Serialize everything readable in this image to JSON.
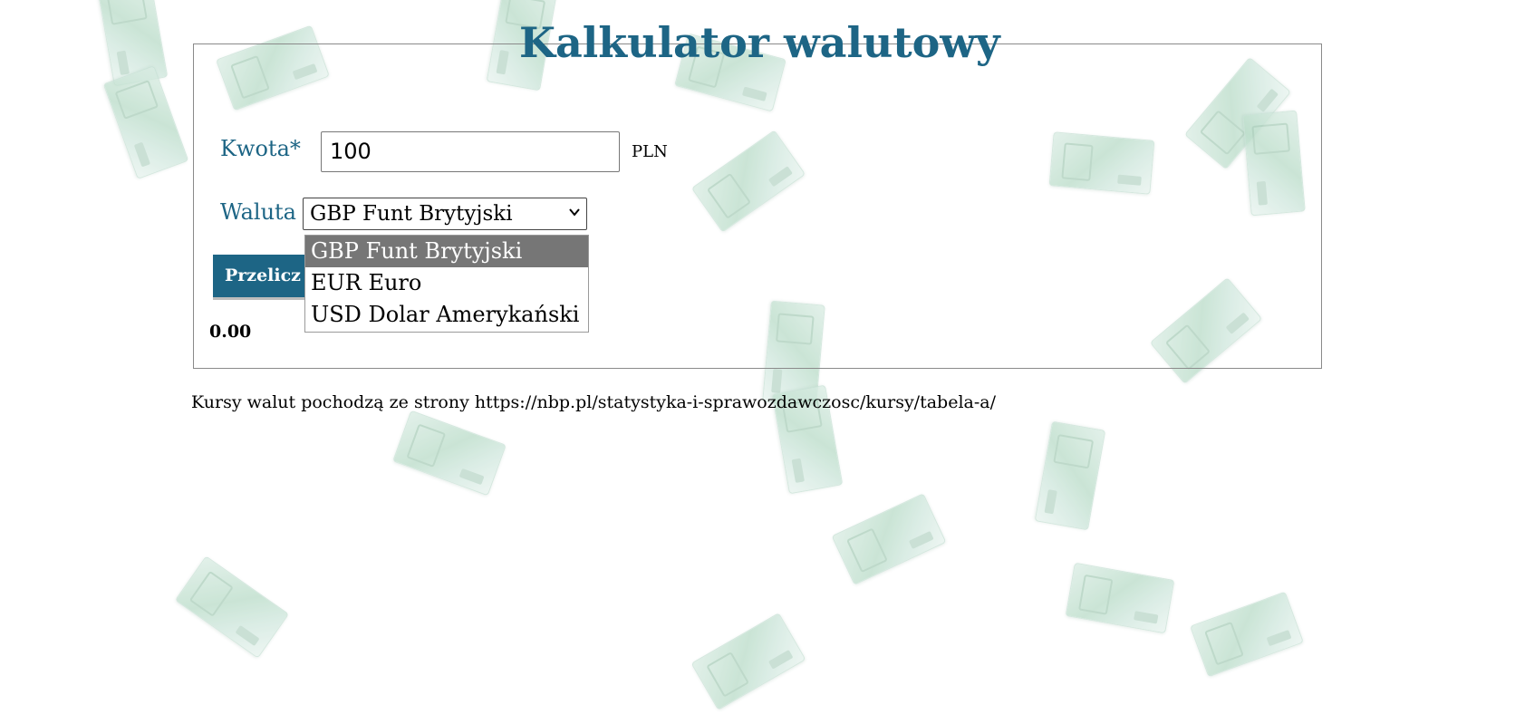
{
  "page": {
    "title": "Kalkulator walutowy"
  },
  "form": {
    "amount_label": "Kwota*",
    "amount_value": "100",
    "amount_unit": "PLN",
    "currency_label": "Waluta",
    "currency_selected": "GBP Funt Brytyjski",
    "currency_options": [
      "GBP Funt Brytyjski",
      "EUR Euro",
      "USD Dolar Amerykański"
    ],
    "calculate_label": "Przelicz",
    "result_value": "0.00"
  },
  "footer": {
    "source_note": "Kursy walut pochodzą ze strony https://nbp.pl/statystyka-i-sprawozdawczosc/kursy/tabela-a/"
  },
  "colors": {
    "accent": "#1d6585",
    "selected_option_bg": "#767676",
    "border": "#8a8a8a"
  }
}
